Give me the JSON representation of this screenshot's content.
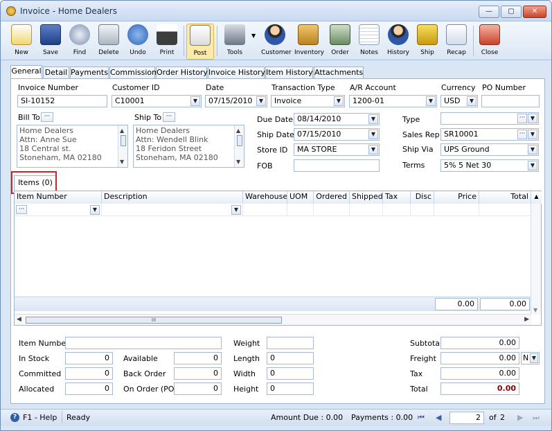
{
  "window": {
    "title": "Invoice - Home Dealers",
    "min": "—",
    "max": "▢",
    "close": "✕"
  },
  "toolbar": [
    {
      "label": "New",
      "icon": "new-icon"
    },
    {
      "label": "Save",
      "icon": "save-icon"
    },
    {
      "label": "Find",
      "icon": "find-icon"
    },
    {
      "label": "Delete",
      "icon": "delete-icon"
    },
    {
      "label": "Undo",
      "icon": "undo-icon"
    },
    {
      "label": "Print",
      "icon": "print-icon"
    },
    {
      "label": "Post",
      "icon": "post-icon"
    },
    {
      "label": "Tools",
      "icon": "tools-icon"
    },
    {
      "label": "Customer",
      "icon": "customer-icon"
    },
    {
      "label": "Inventory",
      "icon": "inventory-icon"
    },
    {
      "label": "Order",
      "icon": "order-icon"
    },
    {
      "label": "Notes",
      "icon": "notes-icon"
    },
    {
      "label": "History",
      "icon": "history-icon"
    },
    {
      "label": "Ship",
      "icon": "ship-icon"
    },
    {
      "label": "Recap",
      "icon": "recap-icon"
    },
    {
      "label": "Close",
      "icon": "close-icon"
    }
  ],
  "tabs": [
    "General",
    "Detail",
    "Payments",
    "Commission",
    "Order History",
    "Invoice History",
    "Item History",
    "Attachments"
  ],
  "header": {
    "invoice_number_label": "Invoice Number",
    "invoice_number": "SI-10152",
    "customer_id_label": "Customer ID",
    "customer_id": "C10001",
    "date_label": "Date",
    "date": "07/15/2010",
    "transaction_type_label": "Transaction Type",
    "transaction_type": "Invoice",
    "ar_account_label": "A/R Account",
    "ar_account": "1200-01",
    "currency_label": "Currency",
    "currency": "USD",
    "po_number_label": "PO Number",
    "po_number": ""
  },
  "bill_to": {
    "label": "Bill To",
    "address": "Home Dealers\nAttn: Anne Sue\n18 Central st.\nStoneham, MA 02180"
  },
  "ship_to": {
    "label": "Ship To",
    "address": "Home Dealers\nAttn: Wendell Blink\n18 Feridon Street\nStoneham, MA 02180"
  },
  "middle": {
    "due_date_label": "Due Date",
    "due_date": "08/14/2010",
    "ship_date_label": "Ship Date",
    "ship_date": "07/15/2010",
    "store_id_label": "Store ID",
    "store_id": "MA STORE",
    "fob_label": "FOB",
    "fob": ""
  },
  "right": {
    "type_label": "Type",
    "type": "",
    "sales_rep_label": "Sales Rep",
    "sales_rep": "SR10001",
    "ship_via_label": "Ship Via",
    "ship_via": "UPS Ground",
    "terms_label": "Terms",
    "terms": "5% 5 Net 30"
  },
  "items_tab": "Items (0)",
  "grid": {
    "columns": [
      "Item Number",
      "Description",
      "Warehouse",
      "UOM",
      "Ordered",
      "Shipped",
      "Tax",
      "Disc",
      "Price",
      "Total"
    ],
    "total_price": "0.00",
    "total_total": "0.00",
    "hscroll_grip": "III"
  },
  "bottom": {
    "item_number_label": "Item Number",
    "item_number": "",
    "in_stock_label": "In Stock",
    "in_stock": "0",
    "committed_label": "Committed",
    "committed": "0",
    "allocated_label": "Allocated",
    "allocated": "0",
    "available_label": "Available",
    "available": "0",
    "back_order_label": "Back Order",
    "back_order": "0",
    "on_order_label": "On Order (PO)",
    "on_order": "0",
    "weight_label": "Weight",
    "weight": "",
    "length_label": "Length",
    "length": "0",
    "width_label": "Width",
    "width": "0",
    "height_label": "Height",
    "height": "0",
    "subtotal_label": "Subtotal",
    "subtotal": "0.00",
    "freight_label": "Freight",
    "freight": "0.00",
    "freight_code": "N",
    "tax_label": "Tax",
    "tax": "0.00",
    "total_label": "Total",
    "total": "0.00"
  },
  "status": {
    "help": "F1 - Help",
    "ready": "Ready",
    "amount_due": "Amount Due : 0.00",
    "payments": "Payments : 0.00",
    "page": "2",
    "of": "of",
    "pages": "2"
  }
}
